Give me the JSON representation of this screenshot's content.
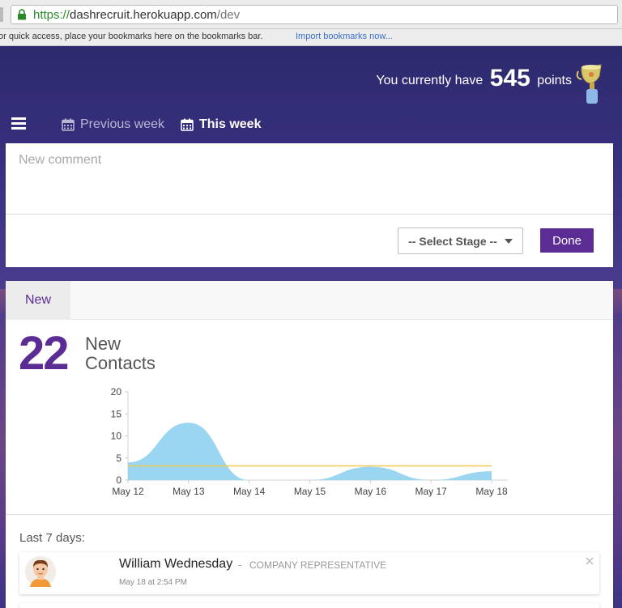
{
  "browser": {
    "url_scheme": "https://",
    "url_host": "dashrecruit.herokuapp.com",
    "url_path": "/dev",
    "bookmarks_message": "or quick access, place your bookmarks here on the bookmarks bar.",
    "import_bookmarks": "Import bookmarks now..."
  },
  "header": {
    "points_prefix": "You currently have",
    "points_value": "545",
    "points_suffix": "points",
    "trophy_icon": "trophy-icon"
  },
  "nav": {
    "previous_week": "Previous week",
    "this_week": "This week"
  },
  "comment": {
    "placeholder": "New comment",
    "select_stage": "-- Select Stage --",
    "done": "Done"
  },
  "stats": {
    "tab_label": "New",
    "count": "22",
    "label_line1": "New",
    "label_line2": "Contacts"
  },
  "chart_data": {
    "type": "area",
    "categories": [
      "May 12",
      "May 13",
      "May 14",
      "May 15",
      "May 16",
      "May 17",
      "May 18"
    ],
    "series": [
      {
        "values": [
          4,
          13,
          0,
          0,
          3,
          0,
          2
        ],
        "color": "#8fd0f0"
      }
    ],
    "average_line": {
      "value": 3.2,
      "color": "#f0c850"
    },
    "yticks": [
      0,
      5,
      10,
      15,
      20
    ],
    "ylim": [
      0,
      20
    ],
    "title": "",
    "xlabel": "",
    "ylabel": ""
  },
  "activity": {
    "section_title": "Last 7 days:",
    "items": [
      {
        "name": "William Wednesday",
        "separator": "-",
        "role": "COMPANY REPRESENTATIVE",
        "time": "May 18 at 2:54 PM"
      }
    ]
  },
  "colors": {
    "accent": "#5b2c93",
    "chart_fill": "#8fd0f0",
    "average_line": "#f0c850"
  }
}
